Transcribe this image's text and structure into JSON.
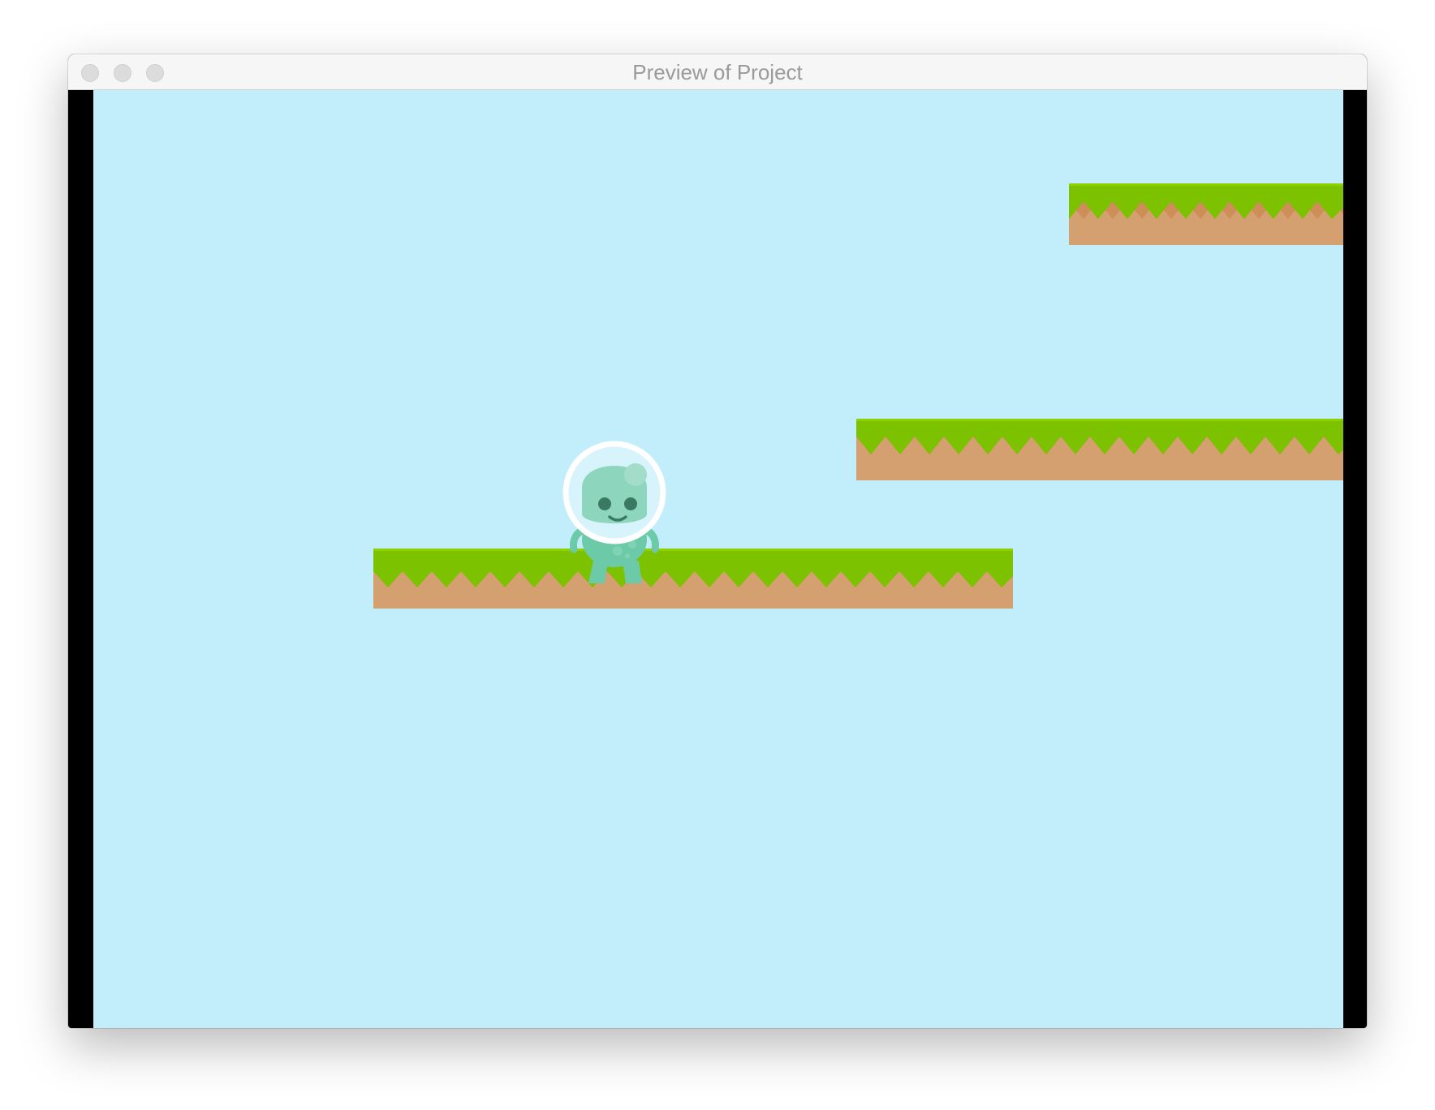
{
  "window": {
    "title": "Preview of Project",
    "controls": [
      "close",
      "minimize",
      "zoom"
    ]
  },
  "scene": {
    "background_color": "#c2eefc",
    "platforms": [
      {
        "name": "platform-top-right",
        "kind": "grass"
      },
      {
        "name": "platform-middle-right",
        "kind": "grass"
      },
      {
        "name": "platform-lower-left",
        "kind": "grass"
      }
    ],
    "player": {
      "name": "alien-astronaut",
      "icon": "alien-player-sprite"
    },
    "colors": {
      "grass": "#7dc200",
      "grass_dark": "#6aa800",
      "dirt": "#cd8f57",
      "dirt_stripe": "#d5a06f",
      "alien_body": "#6ccaa9",
      "alien_head": "#8dd5bd",
      "helmet": "#ffffff",
      "bars": "#000000"
    }
  }
}
